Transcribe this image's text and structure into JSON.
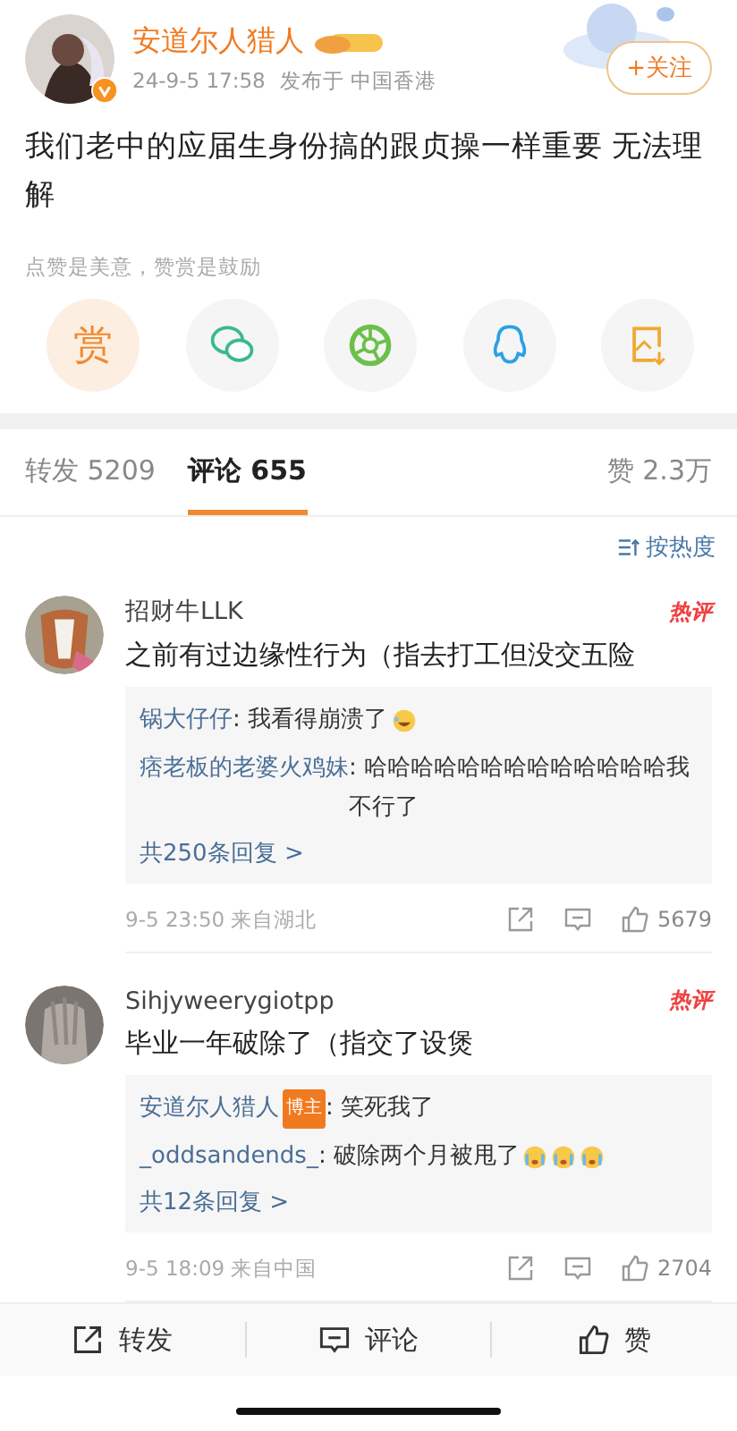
{
  "post": {
    "author": "安道尔人猎人",
    "verified": true,
    "time": "24-9-5 17:58",
    "location": "发布于 中国香港",
    "follow_button": "+关注",
    "text": "我们老中的应届生身份搞的跟贞操一样重要 无法理解",
    "reward_hint": "点赞是美意，赞赏是鼓励"
  },
  "share_buttons": [
    {
      "kind": "reward",
      "label": "赏"
    },
    {
      "kind": "wechat"
    },
    {
      "kind": "moments"
    },
    {
      "kind": "qq"
    },
    {
      "kind": "save-image"
    }
  ],
  "tabs": [
    {
      "label": "转发 5209",
      "selected": false
    },
    {
      "label": "评论 655",
      "selected": true
    }
  ],
  "likes_tab": "赞 2.3万",
  "sort": "按热度",
  "comments": [
    {
      "author": "招财牛LLK",
      "hot_badge": "热评",
      "text": "之前有过边缘性行为（指去打工但没交五险",
      "replies": [
        {
          "author": "锅大仔仔",
          "text": ": 我看得崩溃了",
          "emojis": [
            {
              "kind": "laugh-cry"
            }
          ]
        },
        {
          "author": "痞老板的老婆火鸡妹",
          "text": ": 哈哈哈哈哈哈哈哈哈哈哈哈哈我不行了"
        }
      ],
      "more": "共250条回复 >",
      "time": "9-5 23:50 来自湖北",
      "likes": "5679"
    },
    {
      "author": "Sihjyweerygiotpp",
      "hot_badge": "热评",
      "text": "毕业一年破除了（指交了设煲",
      "replies": [
        {
          "author": "安道尔人猎人",
          "badge": "博主",
          "text": ": 笑死我了"
        },
        {
          "author": "_oddsandends_",
          "text": ": 破除两个月被甩了",
          "emojis": [
            {
              "kind": "crying"
            },
            {
              "kind": "crying"
            },
            {
              "kind": "crying"
            }
          ]
        }
      ],
      "more": "共12条回复 >",
      "time": "9-5 18:09 来自中国",
      "likes": "2704"
    }
  ],
  "bottom_bar": [
    {
      "kind": "repost",
      "label": "转发"
    },
    {
      "kind": "comment",
      "label": "评论"
    },
    {
      "kind": "like",
      "label": "赞"
    }
  ]
}
